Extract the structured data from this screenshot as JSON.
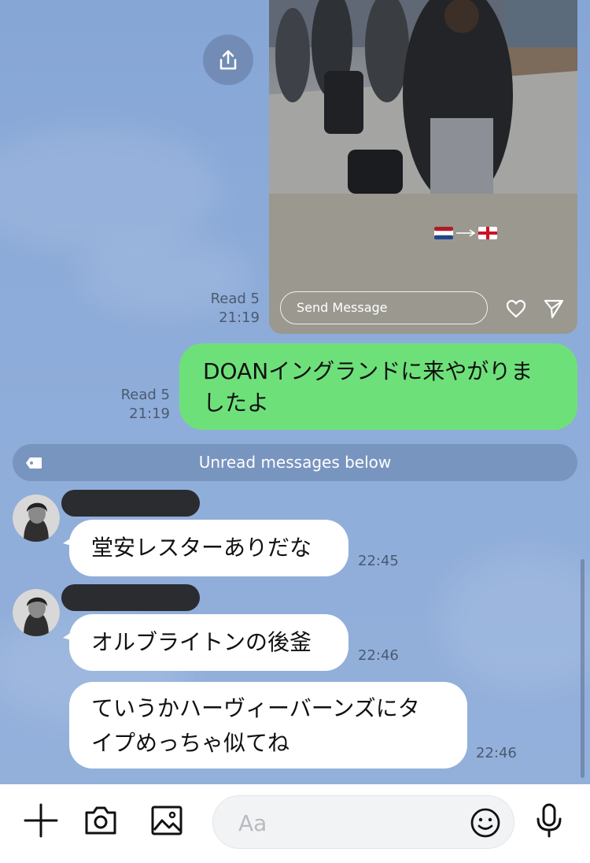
{
  "shared_story": {
    "flags": "🇳🇱→🏴",
    "send_placeholder": "Send Message",
    "read_label": "Read 5",
    "time": "21:19"
  },
  "outgoing": {
    "text_line1": "DOANイングランドに来やがりま",
    "text_line2": "したよ",
    "read_label": "Read 5",
    "time": "21:19"
  },
  "unread_divider": "Unread messages below",
  "incoming": [
    {
      "text": "堂安レスターありだな",
      "time": "22:45"
    },
    {
      "text": "オルブライトンの後釜",
      "time": "22:46"
    },
    {
      "line1": "ていうかハーヴィーバーンズにタ",
      "line2": "イプめっちゃ似てね",
      "time": "22:46"
    }
  ],
  "composer": {
    "placeholder": "Aa"
  },
  "icons": [
    "share-icon",
    "heart-icon",
    "send-icon",
    "tag-icon",
    "plus-icon",
    "camera-icon",
    "image-icon",
    "emoji-icon",
    "microphone-icon"
  ],
  "colors": {
    "outgoing_bubble": "#6ee07a",
    "chat_background": "#8aa9d8",
    "unread_bar": "#7895bf"
  }
}
